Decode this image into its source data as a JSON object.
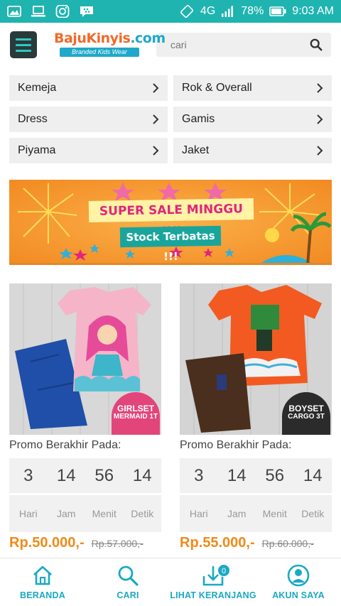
{
  "status_bar": {
    "network": "4G",
    "battery": "78%",
    "time": "9:03 AM",
    "icons": [
      "image-icon",
      "laptop-icon",
      "instagram-icon",
      "bbm-icon",
      "rotate-icon",
      "signal-icon",
      "battery-icon"
    ]
  },
  "header": {
    "logo_main": "BajuKinyis",
    "logo_suffix": ".com",
    "logo_tagline": "Branded Kids Wear",
    "search_placeholder": "cari"
  },
  "categories": [
    {
      "label": "Kemeja"
    },
    {
      "label": "Rok & Overall"
    },
    {
      "label": "Dress"
    },
    {
      "label": "Gamis"
    },
    {
      "label": "Piyama"
    },
    {
      "label": "Jaket"
    }
  ],
  "banner": {
    "title": "SUPER SALE MINGGU INI",
    "subtitle": "Stock Terbatas !!!"
  },
  "products": [
    {
      "badge_line1": "GIRLSET",
      "badge_line2": "MERMAID 1T",
      "badge_color": "#e2457a",
      "promo_label": "Promo Berakhir Pada:",
      "countdown": {
        "days": "3",
        "hours": "14",
        "minutes": "56",
        "seconds": "14"
      },
      "countdown_labels": {
        "days": "Hari",
        "hours": "Jam",
        "minutes": "Menit",
        "seconds": "Detik"
      },
      "price": "Rp.50.000,-",
      "old_price": "Rp.57.000,-"
    },
    {
      "badge_line1": "BOYSET",
      "badge_line2": "CARGO 3T",
      "badge_color": "#2b2b2b",
      "promo_label": "Promo Berakhir Pada:",
      "countdown": {
        "days": "3",
        "hours": "14",
        "minutes": "56",
        "seconds": "14"
      },
      "countdown_labels": {
        "days": "Hari",
        "hours": "Jam",
        "minutes": "Menit",
        "seconds": "Detik"
      },
      "price": "Rp.55.000,-",
      "old_price": "Rp.60.000,-"
    }
  ],
  "bottom_nav": [
    {
      "label": "BERANDA",
      "icon": "home-icon"
    },
    {
      "label": "CARI",
      "icon": "search-icon"
    },
    {
      "label": "LIHAT KERANJANG",
      "icon": "cart-download-icon",
      "badge": "0"
    },
    {
      "label": "AKUN SAYA",
      "icon": "account-icon"
    }
  ],
  "colors": {
    "accent": "#1aa9c4",
    "status_bar": "#1fb4b0",
    "price": "#f08a1a",
    "banner": "#f59b33"
  }
}
